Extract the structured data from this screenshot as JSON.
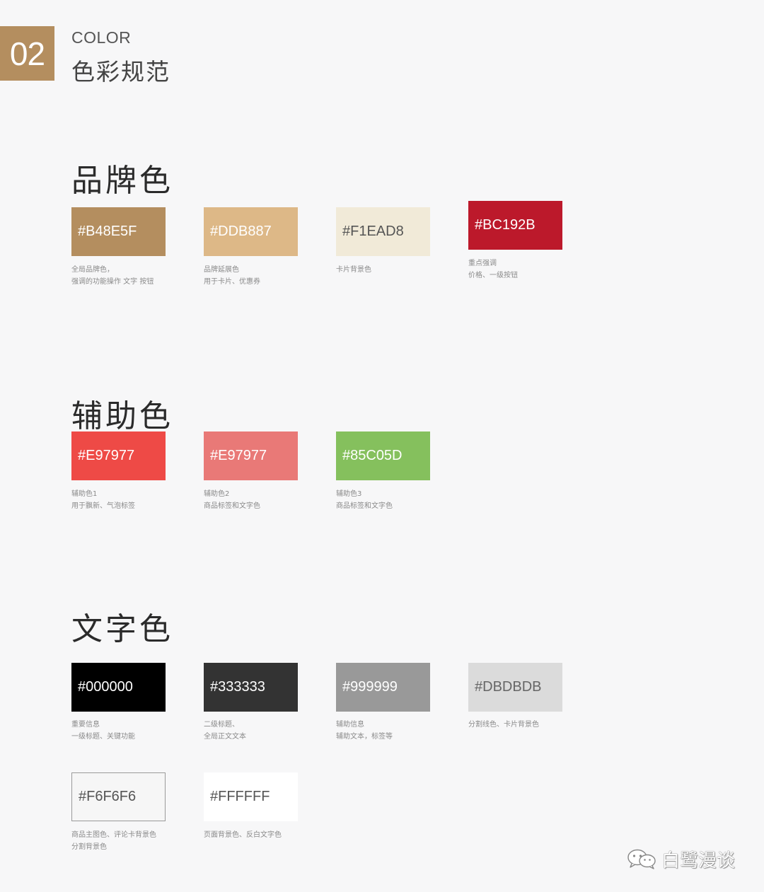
{
  "header": {
    "number": "02",
    "title_en": "COLOR",
    "title_cn": "色彩规范"
  },
  "sections": [
    {
      "title": "品牌色",
      "swatches": [
        {
          "hex": "#B48E5F",
          "fill": "#b48e5f",
          "text_color": "#ffffff",
          "desc": [
            "全局品牌色，",
            "强调的功能操作 文字 按钮"
          ]
        },
        {
          "hex": "#DDB887",
          "fill": "#ddb887",
          "text_color": "#ffffff",
          "desc": [
            "品牌延展色",
            "用于卡片、优惠券"
          ]
        },
        {
          "hex": "#F1EAD8",
          "fill": "#f1ead8",
          "text_color": "#555555",
          "desc": [
            "卡片背景色"
          ]
        },
        {
          "hex": "#BC192B",
          "fill": "#bc192b",
          "text_color": "#ffffff",
          "desc": [
            "重点强调",
            "价格、一级按钮"
          ]
        }
      ]
    },
    {
      "title": "辅助色",
      "swatches": [
        {
          "hex": "#E97977",
          "fill": "#ee4a46",
          "text_color": "#ffffff",
          "desc": [
            "辅助色1",
            "用于飘新、气泡标签"
          ]
        },
        {
          "hex": "#E97977",
          "fill": "#e97977",
          "text_color": "#ffffff",
          "desc": [
            "辅助色2",
            "商品标签和文字色"
          ]
        },
        {
          "hex": "#85C05D",
          "fill": "#85c05d",
          "text_color": "#ffffff",
          "desc": [
            "辅助色3",
            "商品标签和文字色"
          ]
        }
      ]
    },
    {
      "title": "文字色",
      "swatches": [
        {
          "hex": "#000000",
          "fill": "#000000",
          "text_color": "#ffffff",
          "desc": [
            "重要信息",
            "一级标题、关键功能"
          ]
        },
        {
          "hex": "#333333",
          "fill": "#333333",
          "text_color": "#ffffff",
          "desc": [
            "二级标题、",
            "全局正文文本"
          ]
        },
        {
          "hex": "#999999",
          "fill": "#999999",
          "text_color": "#ffffff",
          "desc": [
            "辅助信息",
            "辅助文本，标签等"
          ]
        },
        {
          "hex": "#DBDBDB",
          "fill": "#dbdbdb",
          "text_color": "#666666",
          "desc": [
            "分割线色、卡片背景色"
          ]
        },
        {
          "hex": "#F6F6F6",
          "fill": "#f6f6f6",
          "text_color": "#555555",
          "desc": [
            "商品主图色、评论卡背景色",
            "分割背景色"
          ]
        },
        {
          "hex": "#FFFFFF",
          "fill": "#ffffff",
          "text_color": "#555555",
          "desc": [
            "页面背景色、反白文字色"
          ]
        }
      ]
    }
  ],
  "watermark": {
    "text": "白鹭漫谈",
    "icon": "wechat-icon"
  }
}
